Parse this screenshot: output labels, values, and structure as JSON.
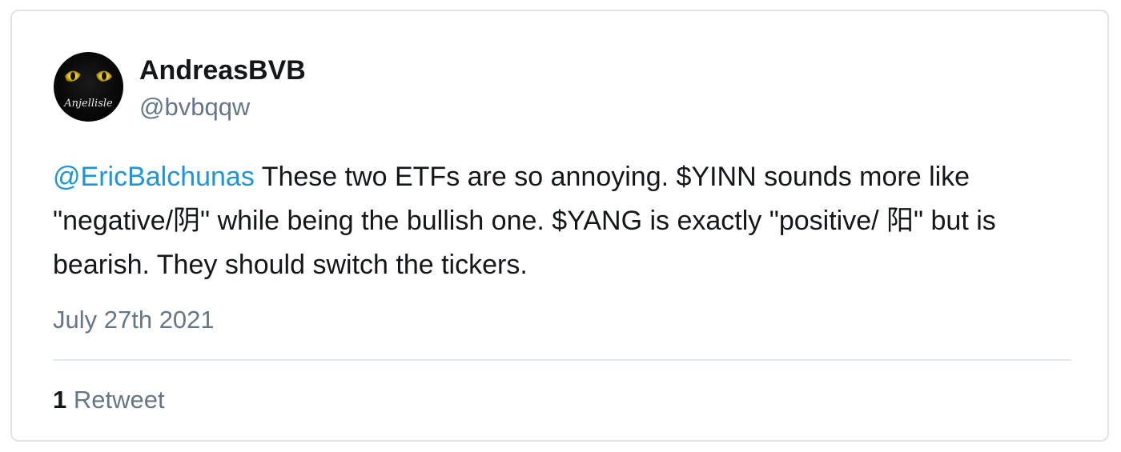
{
  "author": {
    "display_name": "AndreasBVB",
    "handle": "@bvbqqw",
    "avatar_text": "Anjellisle"
  },
  "tweet": {
    "mention": "@EricBalchunas",
    "text_after_mention": " These two ETFs are so annoying. $YINN sounds more like \"negative/阴\" while being the bullish one. $YANG is exactly \"positive/ 阳\" but is bearish. They should switch the tickers.",
    "date": "July 27th 2021"
  },
  "stats": {
    "retweet_count": "1",
    "retweet_label": "Retweet"
  },
  "colors": {
    "mention": "#1b95e0",
    "secondary_text": "#657786",
    "primary_text": "#14171a",
    "border": "#dfe3e7"
  }
}
